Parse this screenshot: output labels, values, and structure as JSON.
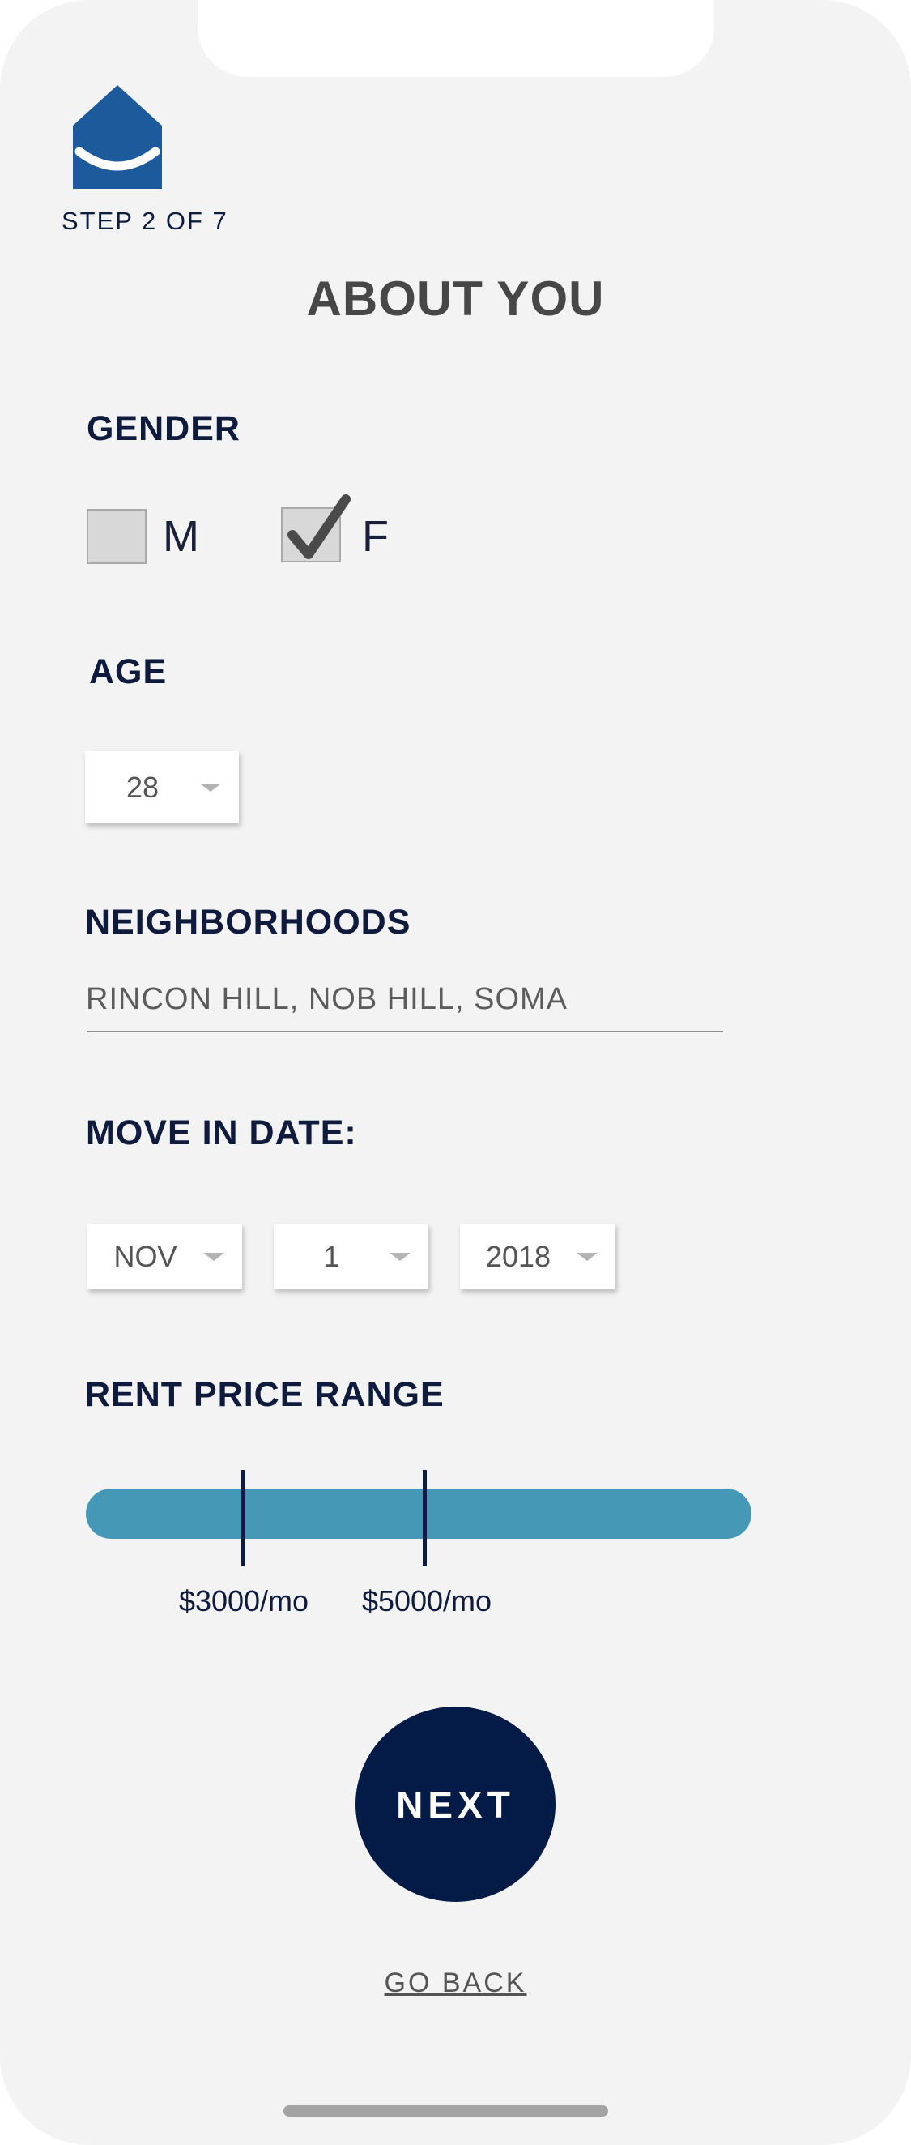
{
  "header": {
    "step": "STEP 2 OF 7",
    "title": "ABOUT YOU",
    "logo_icon": "house-smile-icon"
  },
  "colors": {
    "background": "#f3f3f3",
    "brand_blue": "#1d5a9b",
    "navy": "#041b47",
    "slider_track": "#4599b6"
  },
  "gender": {
    "label": "GENDER",
    "options": [
      {
        "letter": "M",
        "checked": false
      },
      {
        "letter": "F",
        "checked": true
      }
    ]
  },
  "age": {
    "label": "AGE",
    "value": "28"
  },
  "neighborhoods": {
    "label": "NEIGHBORHOODS",
    "value": "RINCON HILL, NOB HILL, SOMA"
  },
  "move_in": {
    "label": "MOVE IN DATE:",
    "month": "NOV",
    "day": "1",
    "year": "2018"
  },
  "rent": {
    "label": "RENT PRICE RANGE",
    "min_label": "$3000/mo",
    "max_label": "$5000/mo"
  },
  "actions": {
    "next": "NEXT",
    "back": "GO BACK"
  }
}
